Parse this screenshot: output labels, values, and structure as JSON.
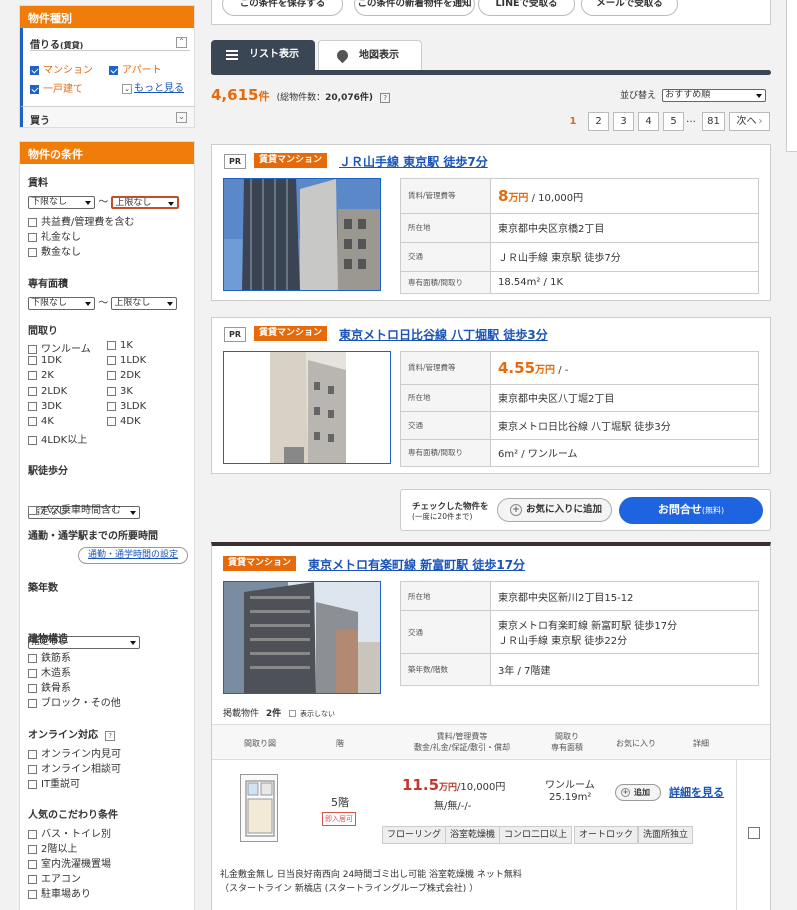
{
  "sidebar": {
    "type_header": "物件種別",
    "rent_label": "借りる",
    "rent_sub": "(賃貸)",
    "types": [
      {
        "label": "マンション",
        "checked": true
      },
      {
        "label": "アパート",
        "checked": true
      },
      {
        "label": "一戸建て",
        "checked": true
      }
    ],
    "more_link": "もっと見る",
    "buy_label": "買う",
    "conditions_header": "物件の条件",
    "rent_title": "賃料",
    "rent_min": "下限なし",
    "rent_max": "上限なし",
    "tilde": "〜",
    "rent_options": [
      "共益費/管理費を含む",
      "礼金なし",
      "敷金なし"
    ],
    "area_title": "専有面積",
    "area_min": "下限なし",
    "area_max": "上限なし",
    "layout_title": "間取り",
    "layouts": [
      "ワンルーム",
      "1K",
      "1DK",
      "1LDK",
      "2K",
      "2DK",
      "2LDK",
      "3K",
      "3DK",
      "3LDK",
      "4K",
      "4DK",
      "4LDK以上"
    ],
    "walk_title": "駅徒歩分",
    "walk_select": "指定なし",
    "bus_option": "バス乗車時間含む",
    "commute_title": "通勤・通学駅までの所要時間",
    "commute_button": "通勤・通学時間の設定",
    "age_title": "築年数",
    "age_select": "指定なし",
    "structure_title": "建物構造",
    "structures": [
      "鉄筋系",
      "木造系",
      "鉄骨系",
      "ブロック・その他"
    ],
    "online_title": "オンライン対応",
    "online_help": "?",
    "online_options": [
      "オンライン内見可",
      "オンライン相談可",
      "IT重説可"
    ],
    "popular_title": "人気のこだわり条件",
    "popular_options": [
      "バス・トイレ別",
      "2階以上",
      "室内洗濯機置場",
      "エアコン",
      "駐車場あり"
    ]
  },
  "topbar": {
    "save_button": "この条件を保存する",
    "notify_button": "この条件の新着物件を通知",
    "line_button": "LINEで受取る",
    "mail_button": "メールで受取る"
  },
  "tabs": {
    "list": "リスト表示",
    "map": "地図表示"
  },
  "results": {
    "count": "4,615",
    "count_unit": "件",
    "total_label": "(総物件数：",
    "total": "20,076件)",
    "help": "?",
    "sort_label": "並び替え",
    "sort_value": "おすすめ順"
  },
  "pagination": {
    "pages": [
      "1",
      "2",
      "3",
      "4",
      "5"
    ],
    "ellipsis": "…",
    "last": "81",
    "next": "次へ"
  },
  "listings": [
    {
      "pr": "PR",
      "tag": "賃貸マンション",
      "title": "ＪＲ山手線 東京駅 徒歩7分",
      "labels": [
        "賃料/管理費等",
        "所在地",
        "交通",
        "専有面積/間取り"
      ],
      "price_big": "8",
      "price_unit": "万円",
      "price_rest": " / 10,000円",
      "address": "東京都中央区京橋2丁目",
      "access": "ＪＲ山手線 東京駅 徒歩7分",
      "area": "18.54m² / 1K"
    },
    {
      "pr": "PR",
      "tag": "賃貸マンション",
      "title": "東京メトロ日比谷線 八丁堀駅 徒歩3分",
      "labels": [
        "賃料/管理費等",
        "所在地",
        "交通",
        "専有面積/間取り"
      ],
      "price_big": "4.55",
      "price_unit": "万円",
      "price_rest": " / -",
      "address": "東京都中央区八丁堀2丁目",
      "access": "東京メトロ日比谷線 八丁堀駅 徒歩3分",
      "area": "6m² / ワンルーム"
    }
  ],
  "actionbar": {
    "checked_label": "チェックした物件を",
    "checked_sub": "(一度に20件まで)",
    "favorite_button": "お気に入りに追加",
    "inquiry_button": "お問合せ",
    "inquiry_sub": "(無料)"
  },
  "building": {
    "tag": "賃貸マンション",
    "title": "東京メトロ有楽町線 新富町駅 徒歩17分",
    "labels": [
      "所在地",
      "交通",
      "築年数/階数"
    ],
    "address": "東京都中央区新川2丁目15-12",
    "access1": "東京メトロ有楽町線 新富町駅 徒歩17分",
    "access2": "ＪＲ山手線 東京駅 徒歩22分",
    "age": "3年 / 7階建",
    "listed_label": "掲載物件",
    "listed_count": "2件",
    "hide_label": "表示しない",
    "columns": [
      "間取り図",
      "階",
      "賃料/管理費等\n敷金/礼金/保証/敷引・償却",
      "間取り\n専有面積",
      "お気に入り",
      "詳細"
    ],
    "unit": {
      "floor": "5階",
      "instant": "即入居可",
      "rent": "11.5",
      "rent_unit": "万円",
      "fee": "/10,000円",
      "deposits": "無/無/-/-",
      "layout": "ワンルーム",
      "area": "25.19m²",
      "add_button": "追加",
      "detail_link": "詳細を見る",
      "features": [
        "フローリング",
        "浴室乾燥機",
        "コンロ二口以上",
        "オートロック",
        "洗面所独立"
      ],
      "notes": "礼金敷金無し 日当良好南西向 24時間ゴミ出し可能 浴室乾燥機 ネット無料",
      "agent": "（スタートライン 新橋店 (スタートライングループ株式会社) ）"
    }
  }
}
